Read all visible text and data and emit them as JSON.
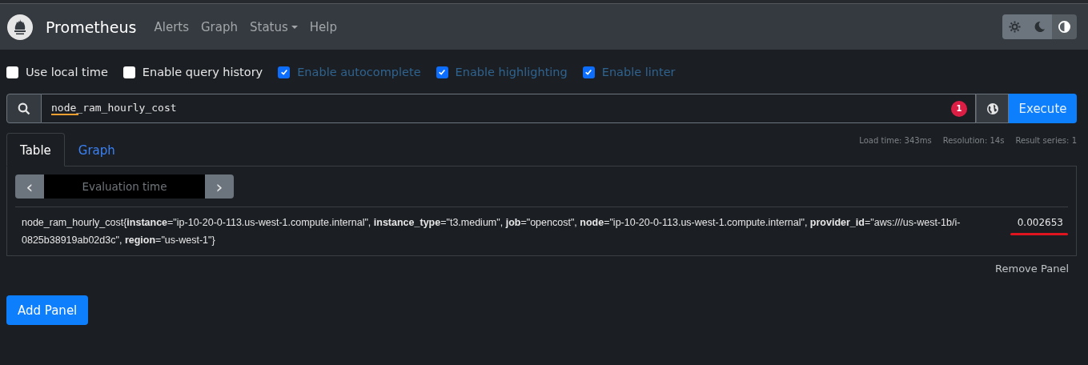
{
  "navbar": {
    "brand": "Prometheus",
    "links": [
      {
        "label": "Alerts",
        "dropdown": false
      },
      {
        "label": "Graph",
        "dropdown": false
      },
      {
        "label": "Status",
        "dropdown": true
      },
      {
        "label": "Help",
        "dropdown": false
      }
    ],
    "theme_buttons": [
      {
        "kind": "light",
        "selected": false
      },
      {
        "kind": "dark",
        "selected": false
      },
      {
        "kind": "auto",
        "selected": true
      }
    ]
  },
  "options": [
    {
      "label": "Use local time",
      "checked": false
    },
    {
      "label": "Enable query history",
      "checked": false
    },
    {
      "label": "Enable autocomplete",
      "checked": true
    },
    {
      "label": "Enable highlighting",
      "checked": true
    },
    {
      "label": "Enable linter",
      "checked": true
    }
  ],
  "query": {
    "value": "node_ram_hourly_cost",
    "lint_count": "1",
    "execute": "Execute"
  },
  "stats": [
    "Load time: 343ms",
    "Resolution: 14s",
    "Result series: 1"
  ],
  "tabs": [
    {
      "label": "Table",
      "selected": true
    },
    {
      "label": "Graph",
      "selected": false
    }
  ],
  "evaluation": {
    "placeholder": "Evaluation time",
    "prev": "‹",
    "next": "›"
  },
  "rows": [
    {
      "series": "node_ram_hourly_cost{**instance**=\"ip-10-20-0-113.us-west-1.compute.internal\", **instance_type**=\"t3.medium\", **job**=\"opencost\", **node**=\"ip-10-20-0-113.us-west-1.compute.internal\", **provider_id**=\"aws:///us-west-1b/i-0825b38919ab02d3c\", **region**=\"us-west-1\"}",
      "value": "0.002653",
      "underlined": true
    }
  ],
  "remove_panel": "Remove Panel",
  "add_panel": "Add Panel"
}
